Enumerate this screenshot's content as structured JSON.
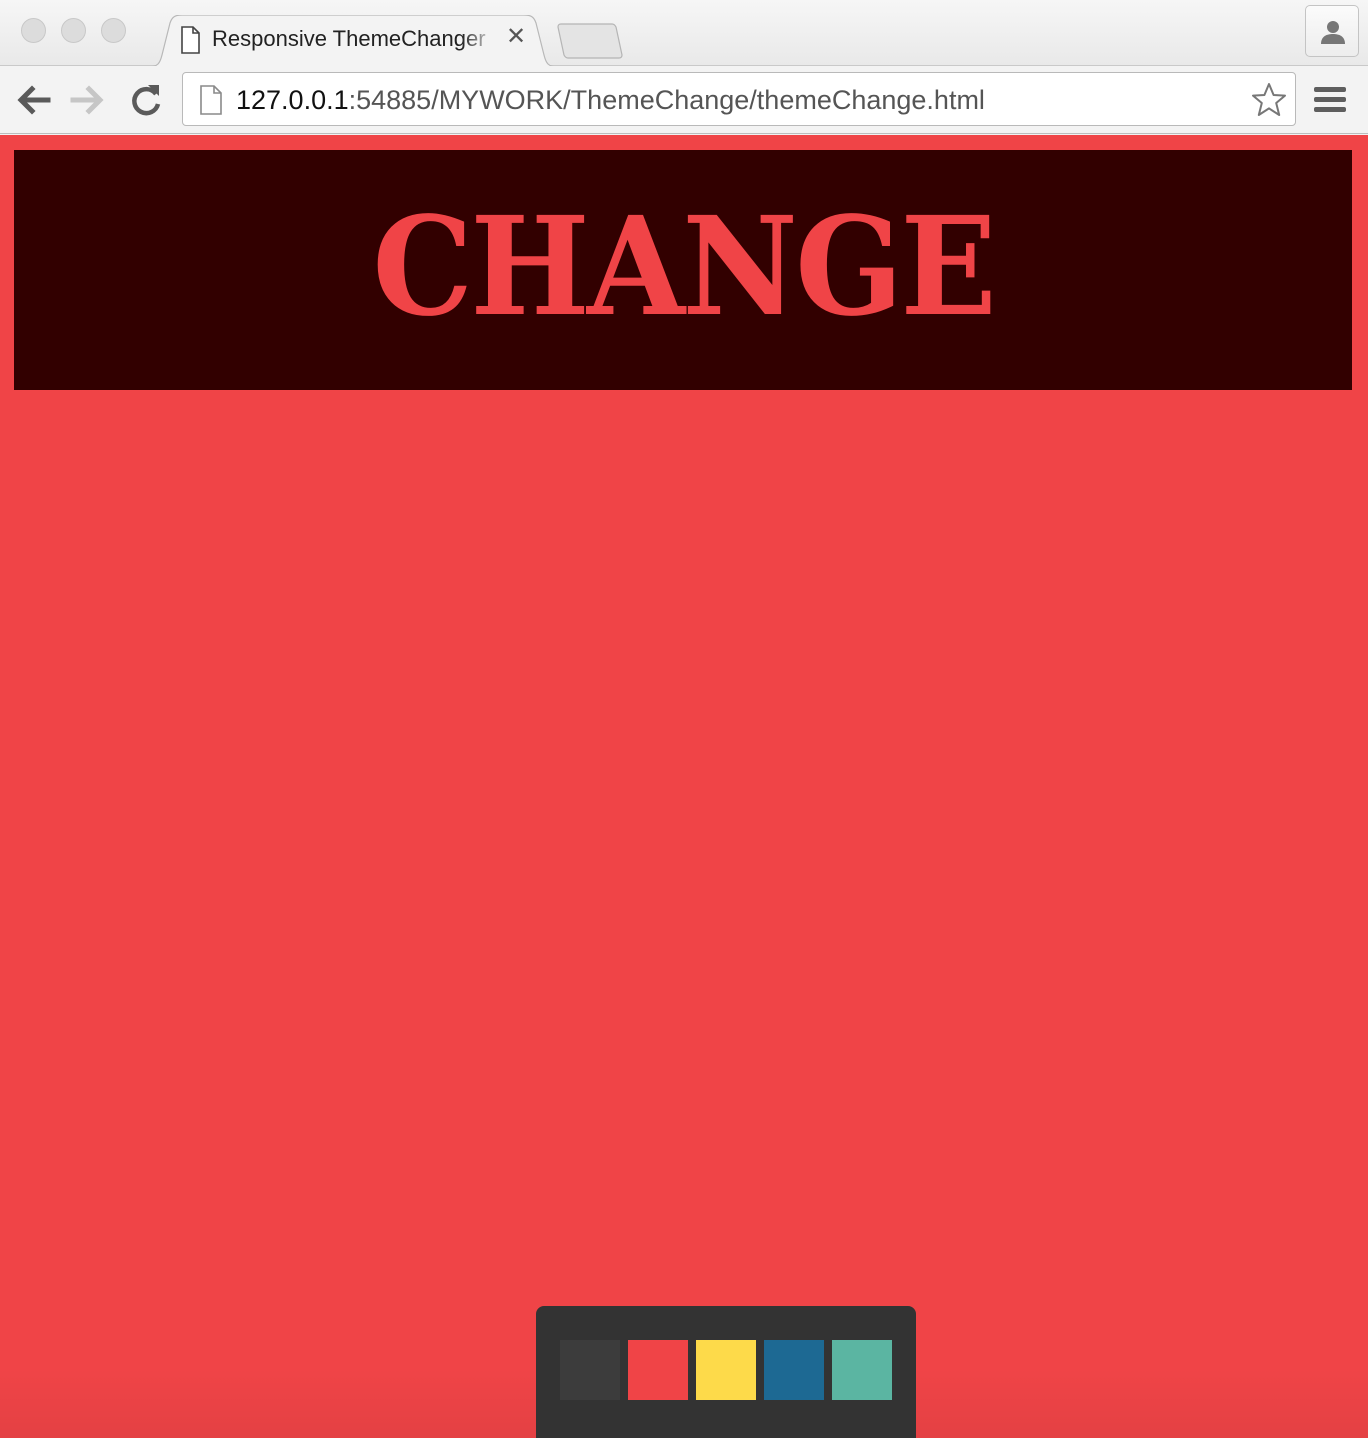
{
  "browser": {
    "tab_title": "Responsive ThemeChanger",
    "tab_close_glyph": "✕",
    "url_host": "127.0.0.1",
    "url_rest": ":54885/MYWORK/ThemeChange/themeChange.html"
  },
  "page": {
    "heading": "CHANGE",
    "background_color": "#f04447",
    "banner_color": "#320000",
    "heading_color": "#f04447"
  },
  "theme_switcher": {
    "panel_color": "#333333",
    "swatches": [
      {
        "name": "dark",
        "color": "#3c3c3c"
      },
      {
        "name": "red",
        "color": "#f04447"
      },
      {
        "name": "yellow",
        "color": "#fdda4a"
      },
      {
        "name": "blue",
        "color": "#1d6993"
      },
      {
        "name": "teal",
        "color": "#5bb5a2"
      }
    ]
  }
}
